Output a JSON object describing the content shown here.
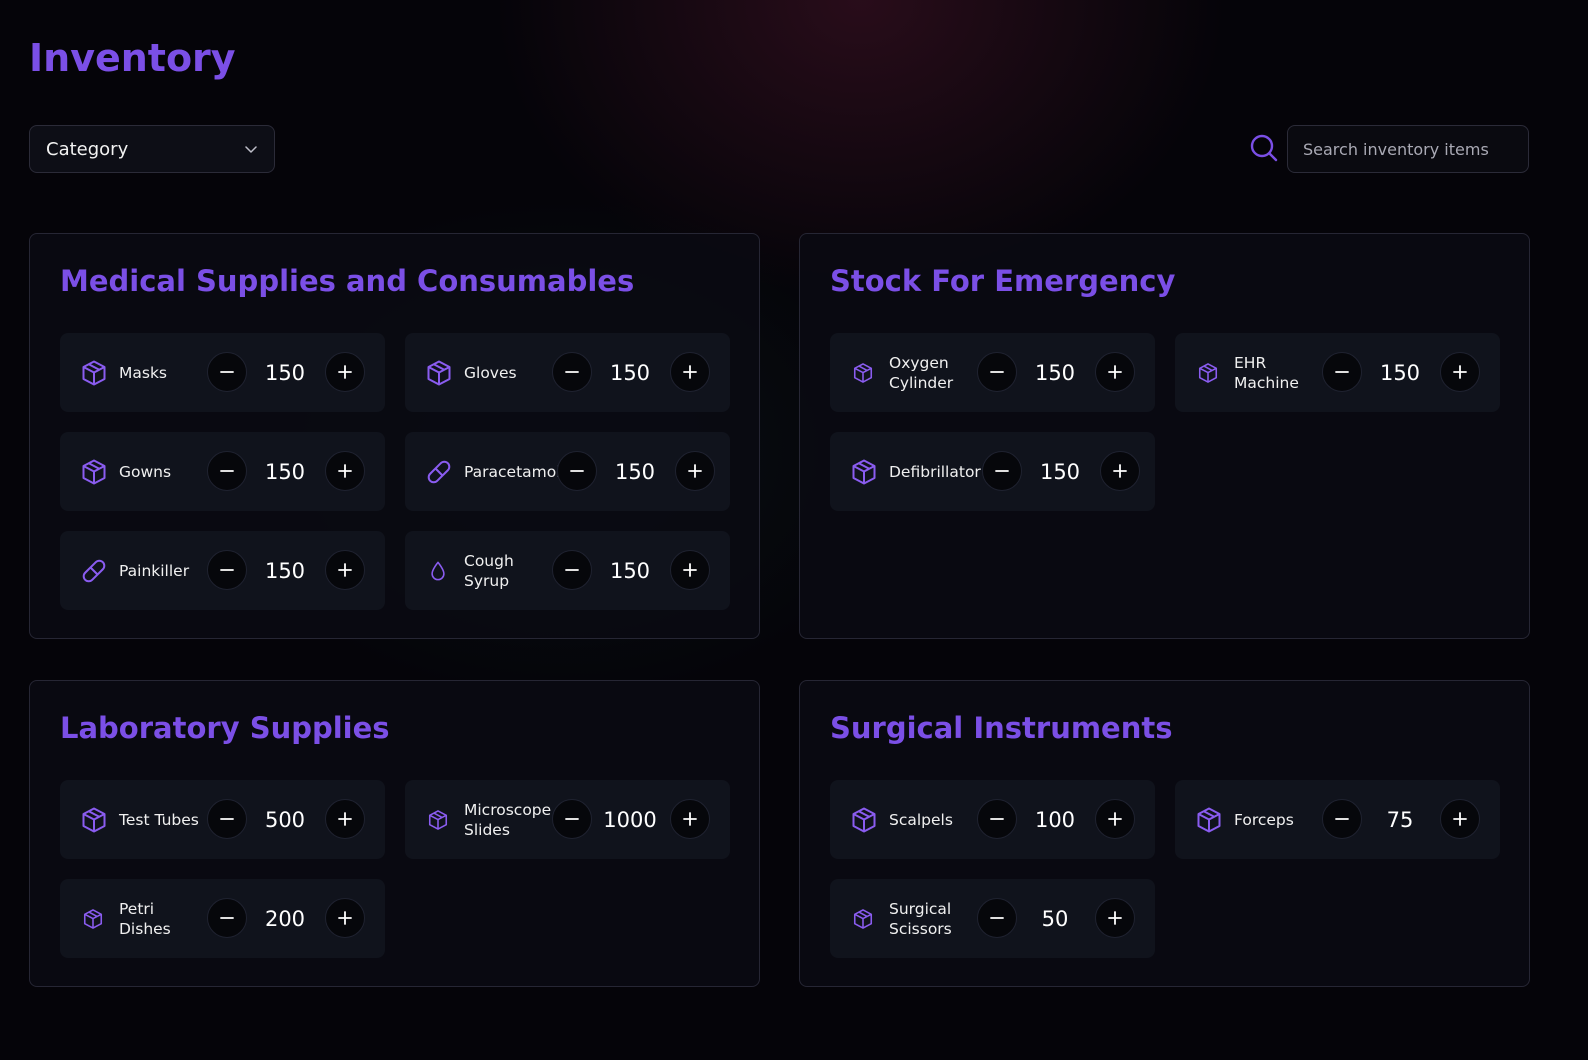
{
  "title": "Inventory",
  "category_select": {
    "label": "Category"
  },
  "search": {
    "placeholder": "Search inventory items"
  },
  "accent_color": "#7b4fe6",
  "panels": [
    {
      "title": "Medical Supplies and Consumables",
      "items": [
        {
          "name": "Masks",
          "qty": "150",
          "icon": "box-icon"
        },
        {
          "name": "Gloves",
          "qty": "150",
          "icon": "box-icon"
        },
        {
          "name": "Gowns",
          "qty": "150",
          "icon": "box-icon"
        },
        {
          "name": "Paracetamol",
          "qty": "150",
          "icon": "pill-icon"
        },
        {
          "name": "Painkiller",
          "qty": "150",
          "icon": "pill-icon"
        },
        {
          "name": "Cough\nSyrup",
          "qty": "150",
          "icon": "droplet-icon"
        }
      ]
    },
    {
      "title": "Stock For Emergency",
      "items": [
        {
          "name": "Oxygen\nCylinder",
          "qty": "150",
          "icon": "box-icon"
        },
        {
          "name": "EHR\nMachine",
          "qty": "150",
          "icon": "box-icon"
        },
        {
          "name": "Defibrillator",
          "qty": "150",
          "icon": "box-icon"
        }
      ]
    },
    {
      "title": "Laboratory Supplies",
      "items": [
        {
          "name": "Test Tubes",
          "qty": "500",
          "icon": "box-icon"
        },
        {
          "name": "Microscope\nSlides",
          "qty": "1000",
          "icon": "box-icon"
        },
        {
          "name": "Petri\nDishes",
          "qty": "200",
          "icon": "box-icon"
        }
      ]
    },
    {
      "title": "Surgical Instruments",
      "items": [
        {
          "name": "Scalpels",
          "qty": "100",
          "icon": "box-icon"
        },
        {
          "name": "Forceps",
          "qty": "75",
          "icon": "box-icon"
        },
        {
          "name": "Surgical\nScissors",
          "qty": "50",
          "icon": "box-icon"
        }
      ]
    }
  ]
}
